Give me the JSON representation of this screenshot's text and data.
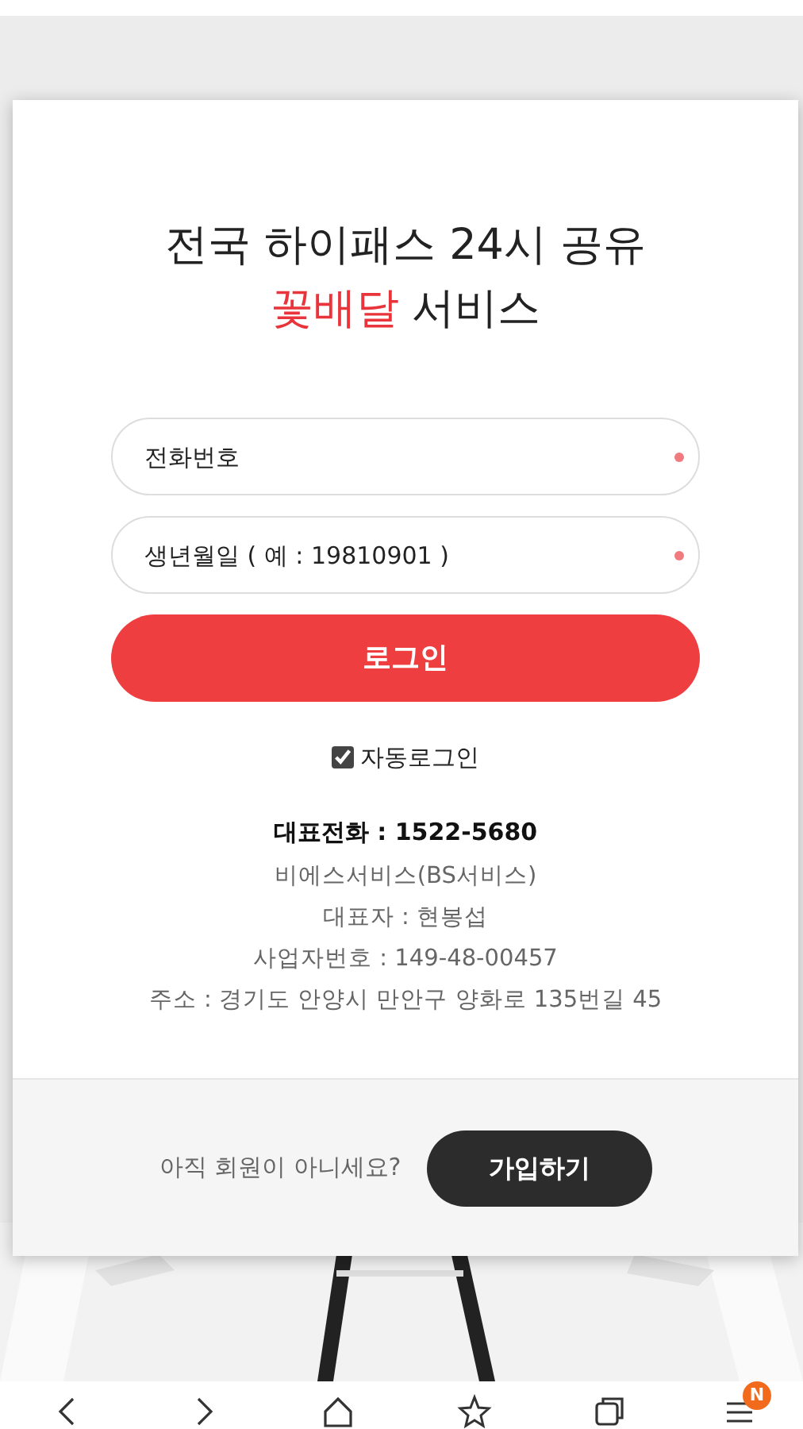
{
  "title": {
    "line_1": "전국 하이패스 24시 공유",
    "line_2": [
      {
        "text": "꽃배달",
        "highlight": true
      },
      {
        "text": "서비스",
        "highlight": false
      }
    ]
  },
  "fields": [
    {
      "placeholder": "전화번호",
      "required": true
    },
    {
      "placeholder": "생년월일 ( 예 : 19810901 )",
      "required": true
    }
  ],
  "login_button": "로그인",
  "auto_login": {
    "label": "자동로그인",
    "checked": true
  },
  "company": {
    "phone": "대표전화 : 1522-5680",
    "lines": [
      "비에스서비스(BS서비스)",
      "대표자 : 현봉섭",
      "사업자번호 : 149-48-00457",
      "주소 : 경기도 안양시 만안구 양화로 135번길 45"
    ]
  },
  "footer": {
    "prompt": "아직 회원이 아니세요?",
    "signup_button": "가입하기"
  },
  "nav_bar": {
    "badge": "N"
  }
}
